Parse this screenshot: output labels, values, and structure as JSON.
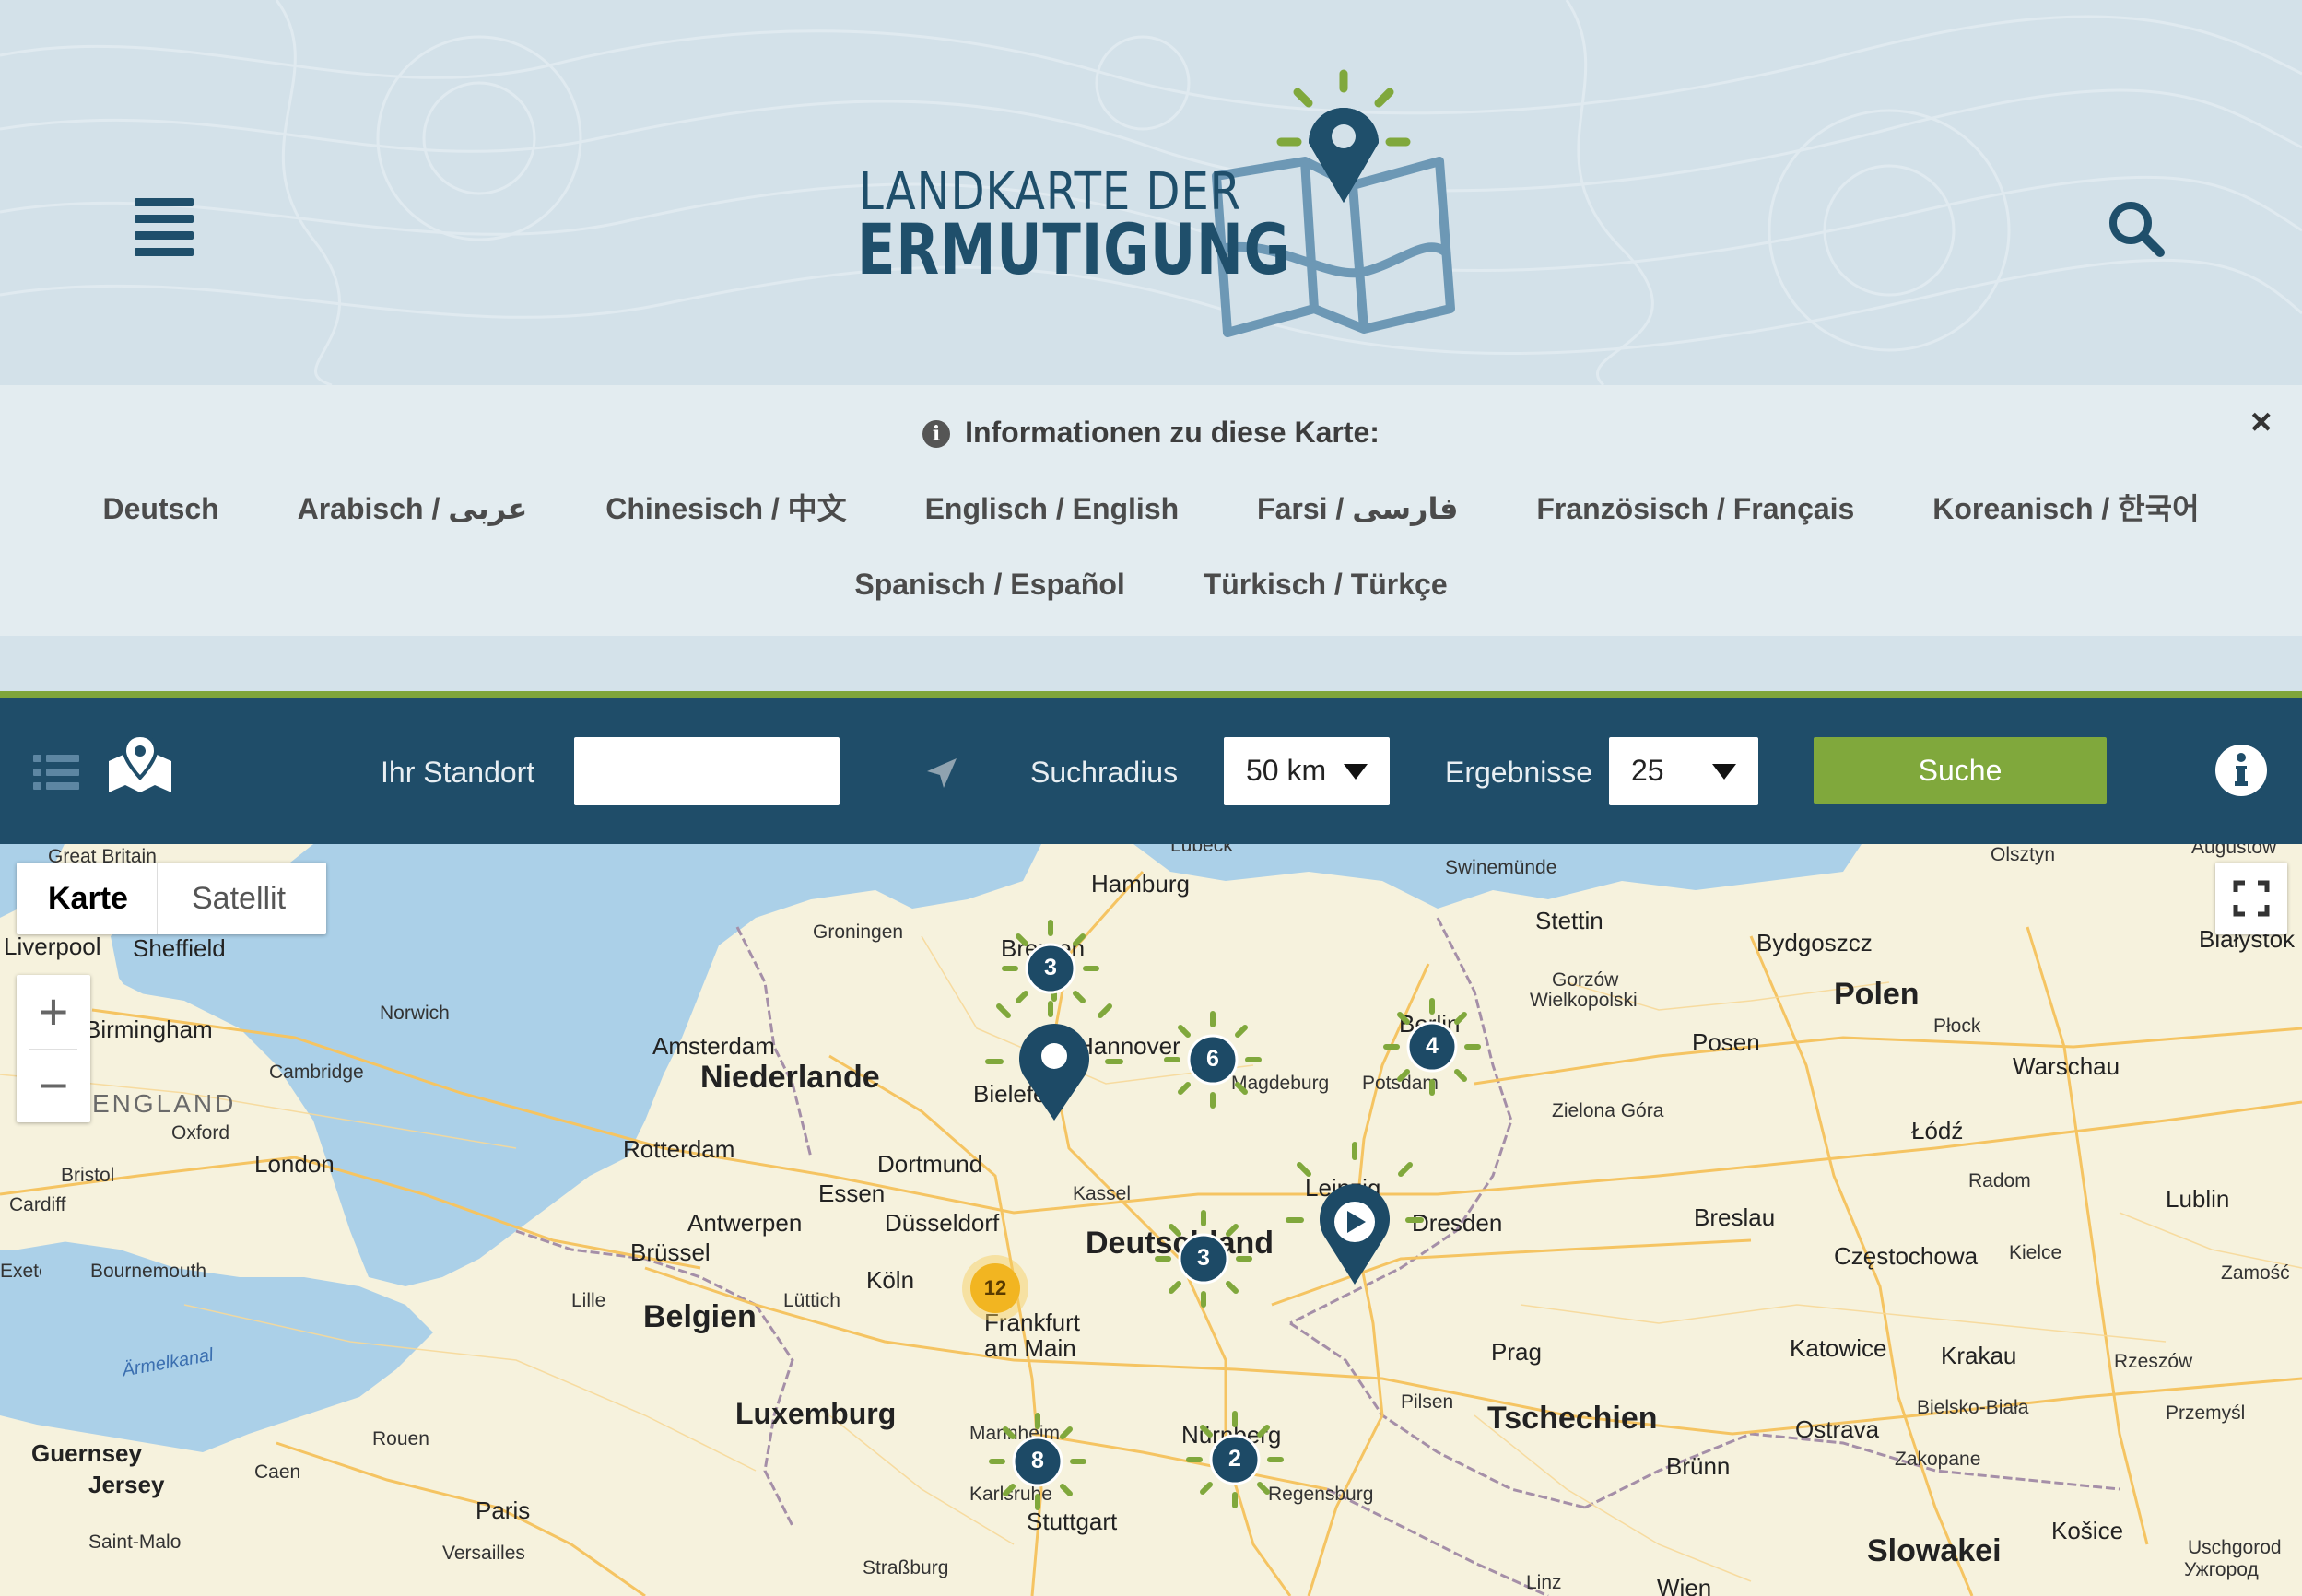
{
  "header": {
    "logo_line1": "LANDKARTE DER",
    "logo_line2": "ERMUTIGUNG"
  },
  "info": {
    "title": "Informationen zu diese Karte:",
    "close": "×",
    "languages_row1": [
      "Deutsch",
      "Arabisch / عربى",
      "Chinesisch / 中文",
      "Englisch / English",
      "Farsi / فارسی",
      "Französisch / Français",
      "Koreanisch / 한국어"
    ],
    "languages_row2": [
      "Spanisch / Español",
      "Türkisch / Türkçe"
    ]
  },
  "toolbar": {
    "location_label": "Ihr Standort",
    "location_value": "",
    "radius_label": "Suchradius",
    "radius_value": "50 km",
    "results_label": "Ergebnisse",
    "results_value": "25",
    "search_button": "Suche"
  },
  "map": {
    "type_options": [
      "Karte",
      "Satellit"
    ],
    "selected_type": "Karte",
    "zoom_in": "+",
    "zoom_out": "−",
    "clusters": [
      {
        "label": "3",
        "near": "Bremen"
      },
      {
        "label": "6",
        "near": "Magdeburg"
      },
      {
        "label": "4",
        "near": "Berlin"
      },
      {
        "label": "3",
        "near": "Deutschland"
      },
      {
        "label": "12",
        "near": "Frankfurt am Main"
      },
      {
        "label": "8",
        "near": "Karlsruhe"
      },
      {
        "label": "2",
        "near": "Nürnberg"
      }
    ],
    "places": {
      "great_britain": "Great Britain",
      "liverpool": "Liverpool",
      "sheffield": "Sheffield",
      "birmingham": "Birmingham",
      "norwich": "Norwich",
      "cambridge": "Cambridge",
      "england": "ENGLAND",
      "oxford": "Oxford",
      "london": "London",
      "bristol": "Bristol",
      "cardiff": "Cardiff",
      "exeter": "Exeter",
      "bournemouth": "Bournemouth",
      "armelkanal": "Ärmelkanal",
      "guernsey": "Guernsey",
      "jersey": "Jersey",
      "saint_malo": "Saint-Malo",
      "caen": "Caen",
      "rouen": "Rouen",
      "paris": "Paris",
      "versailles": "Versailles",
      "lille": "Lille",
      "groningen": "Groningen",
      "amsterdam": "Amsterdam",
      "niederlande": "Niederlande",
      "rotterdam": "Rotterdam",
      "antwerpen": "Antwerpen",
      "brussel": "Brüssel",
      "belgien": "Belgien",
      "luttich": "Lüttich",
      "luxemburg": "Luxemburg",
      "strassburg": "Straßburg",
      "essen": "Essen",
      "dortmund": "Dortmund",
      "dusseldorf": "Düsseldorf",
      "koln": "Köln",
      "frankfurt": "Frankfurt",
      "am_main": "am Main",
      "mannheim": "Mannheim",
      "karlsruhe": "Karlsruhe",
      "stuttgart": "Stuttgart",
      "kassel": "Kassel",
      "deutschland": "Deutschland",
      "bielefeld": "Bielefeld",
      "hannover": "Hannover",
      "bremen": "Bremen",
      "hamburg": "Hamburg",
      "lubeck": "Lübeck",
      "magdeburg": "Magdeburg",
      "potsdam": "Potsdam",
      "berlin": "Berlin",
      "leipzig": "Leipzig",
      "dresden": "Dresden",
      "nurnberg": "Nürnberg",
      "regensburg": "Regensburg",
      "pilsen": "Pilsen",
      "prag": "Prag",
      "tschechien": "Tschechien",
      "brunn": "Brünn",
      "linz": "Linz",
      "wien": "Wien",
      "swinemunde": "Swinemünde",
      "stettin": "Stettin",
      "gorzow": "Gorzów",
      "wielkopolski": "Wielkopolski",
      "zielona_gora": "Zielona Góra",
      "posen": "Posen",
      "breslau": "Breslau",
      "bydgoszcz": "Bydgoszcz",
      "polen": "Polen",
      "plock": "Płock",
      "warschau": "Warschau",
      "lodz": "Łódź",
      "radom": "Radom",
      "lublin": "Lublin",
      "czestochowa": "Częstochowa",
      "kielce": "Kielce",
      "katowice": "Katowice",
      "krakau": "Krakau",
      "ostrava": "Ostrava",
      "bielsko": "Bielsko-Biała",
      "zakopane": "Zakopane",
      "rzeszow": "Rzeszów",
      "przemysl": "Przemyśl",
      "zamosc": "Zamość",
      "olsztyn": "Olsztyn",
      "augustow": "Augustów",
      "bialystok": "Białystok",
      "slowakei": "Slowakei",
      "kosice": "Košice",
      "uschgorod": "Uschgorod",
      "uzhgorod": "Ужгород"
    }
  },
  "colors": {
    "primary": "#1f4d69",
    "accent": "#80a83c",
    "header_bg": "#d3e1e9",
    "info_bg": "#e3ecf0",
    "cluster_orange": "#f2b521"
  }
}
